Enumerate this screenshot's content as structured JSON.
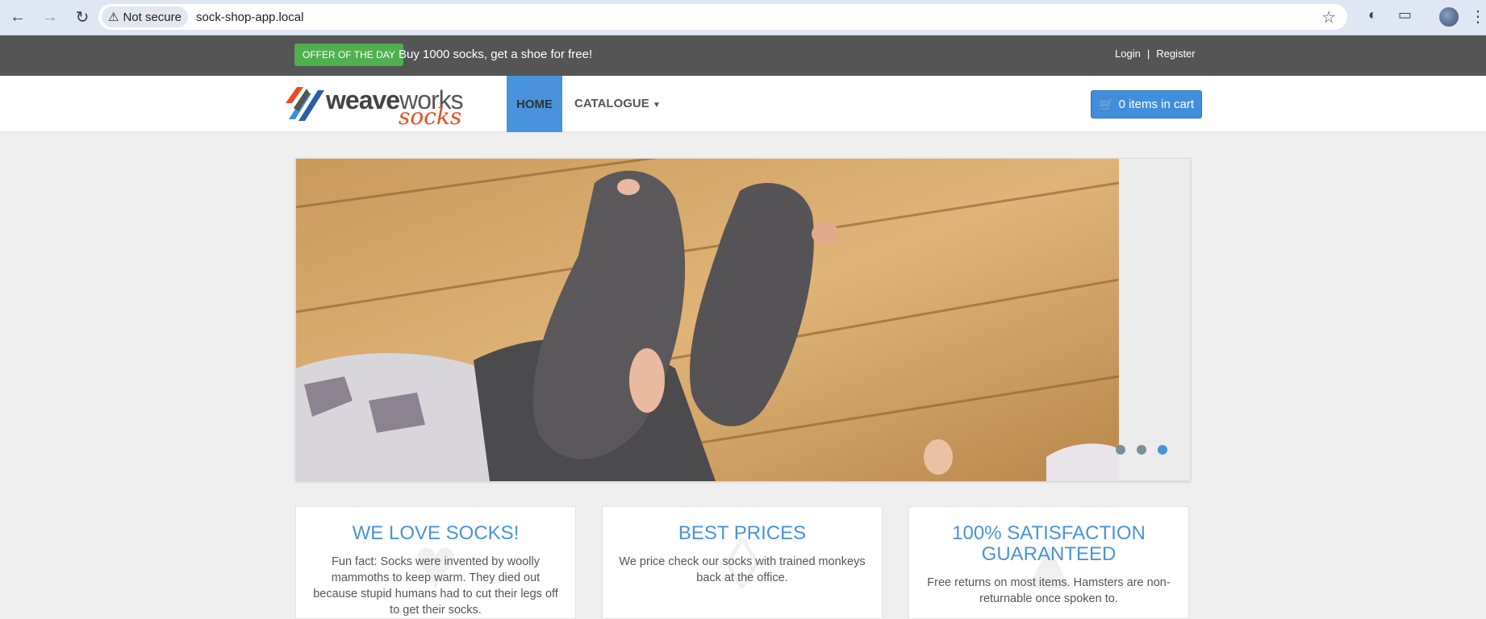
{
  "browser": {
    "security_label": "Not secure",
    "url": "sock-shop-app.local"
  },
  "topbar": {
    "offer_badge": "OFFER OF THE DAY",
    "offer_text": "Buy 1000 socks, get a shoe for free!",
    "login": "Login",
    "separator": "|",
    "register": "Register"
  },
  "header": {
    "logo_word1_bold": "weave",
    "logo_word1_light": "works",
    "logo_word2": "socks",
    "nav": {
      "home": "HOME",
      "catalogue": "CATALOGUE"
    },
    "cart_label": "0 items in cart"
  },
  "carousel": {
    "active_index": 2,
    "slide_count": 3
  },
  "features": [
    {
      "title": "WE LOVE SOCKS!",
      "text": "Fun fact: Socks were invented by woolly mammoths to keep warm. They died out because stupid humans had to cut their legs off to get their socks."
    },
    {
      "title": "BEST PRICES",
      "text": "We price check our socks with trained monkeys back at the office."
    },
    {
      "title": "100% SATISFACTION GUARANTEED",
      "text": "Free returns on most items. Hamsters are non-returnable once spoken to."
    }
  ],
  "colors": {
    "accent": "#4993dd",
    "offer_green": "#4fb04f",
    "topbar": "#555555",
    "brand_orange": "#e94d1f"
  }
}
